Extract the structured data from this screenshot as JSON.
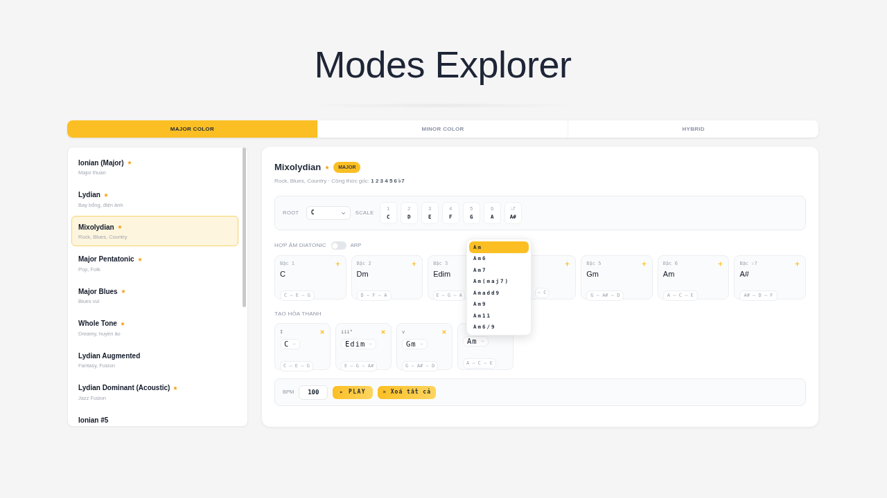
{
  "title": "Modes Explorer",
  "tabs": [
    {
      "label": "MAJOR COLOR",
      "selected": true
    },
    {
      "label": "MINOR COLOR",
      "selected": false
    },
    {
      "label": "HYBRID",
      "selected": false
    }
  ],
  "sidebar": {
    "items": [
      {
        "name": "Ionian (Major)",
        "starred": true,
        "description": "Major thuần",
        "selected": false
      },
      {
        "name": "Lydian",
        "starred": true,
        "description": "Bay bổng, điện ảnh",
        "selected": false
      },
      {
        "name": "Mixolydian",
        "starred": true,
        "description": "Rock, Blues, Country",
        "selected": true
      },
      {
        "name": "Major Pentatonic",
        "starred": true,
        "description": "Pop, Folk",
        "selected": false
      },
      {
        "name": "Major Blues",
        "starred": true,
        "description": "Blues vui",
        "selected": false
      },
      {
        "name": "Whole Tone",
        "starred": true,
        "description": "Dreamy, huyền ảo",
        "selected": false
      },
      {
        "name": "Lydian Augmented",
        "starred": false,
        "description": "Fantasy, Fusion",
        "selected": false
      },
      {
        "name": "Lydian Dominant (Acoustic)",
        "starred": true,
        "description": "Jazz Fusion",
        "selected": false
      },
      {
        "name": "Ionian #5",
        "starred": false,
        "selected": false
      }
    ]
  },
  "mode": {
    "name": "Mixolydian",
    "starred": true,
    "badge": "MAJOR",
    "description": "Rock, Blues, Country · Công thức gốc: **1 2 3 4 5 6 ♭7**"
  },
  "root_bar": {
    "root_label": "ROOT",
    "root": "C",
    "scale_label": "SCALE",
    "scale": [
      {
        "degree": "1",
        "note": "C"
      },
      {
        "degree": "2",
        "note": "D"
      },
      {
        "degree": "3",
        "note": "E"
      },
      {
        "degree": "4",
        "note": "F"
      },
      {
        "degree": "5",
        "note": "G"
      },
      {
        "degree": "6",
        "note": "A"
      },
      {
        "degree": "♭7",
        "note": "A#"
      }
    ]
  },
  "diatonic": {
    "label": "HỢP ÂM DIATONIC",
    "arp": {
      "label": "ARP",
      "on": false
    },
    "chords": [
      {
        "kind": "full",
        "degree": "Bậc 1",
        "name": "C",
        "notes": "C – E – G"
      },
      {
        "kind": "full",
        "degree": "Bậc 2",
        "name": "Dm",
        "notes": "D – F – A"
      },
      {
        "kind": "right_covered",
        "degree": "Bậc 3",
        "name": "Edim",
        "notes": "E – G – A"
      },
      {
        "kind": "left_covered",
        "notes": "– C"
      },
      {
        "kind": "full",
        "degree": "Bậc 5",
        "name": "Gm",
        "notes": "G – A# – D"
      },
      {
        "kind": "full",
        "degree": "Bậc 6",
        "name": "Am",
        "notes": "A – C – E"
      },
      {
        "kind": "full",
        "degree": "Bậc ♭7",
        "name": "A#",
        "notes": "A# – D – F"
      }
    ]
  },
  "progression": {
    "label": "TẠO HÒA THANH",
    "chords": [
      {
        "kind": "full",
        "numeral": "I",
        "chord": "C",
        "notes": "C – E – G"
      },
      {
        "kind": "full",
        "numeral": "iii°",
        "chord": "Edim",
        "notes": "E – G – A#"
      },
      {
        "kind": "full",
        "numeral": "v",
        "chord": "Gm",
        "notes": "G – A# – D"
      },
      {
        "kind": "top_covered",
        "chord": "Am",
        "notes": "A – C – E"
      }
    ],
    "dropdown": {
      "options": [
        {
          "label": "Am",
          "selected": true
        },
        {
          "label": "Am6",
          "selected": false
        },
        {
          "label": "Am7",
          "selected": false
        },
        {
          "label": "Am(maj7)",
          "selected": false
        },
        {
          "label": "Amadd9",
          "selected": false
        },
        {
          "label": "Am9",
          "selected": false
        },
        {
          "label": "Am11",
          "selected": false
        },
        {
          "label": "Am6/9",
          "selected": false
        }
      ]
    }
  },
  "transport": {
    "bpm_label": "BPM",
    "bpm": "100",
    "play": "▸ PLAY",
    "clear": "✕ Xoá tất cả"
  }
}
